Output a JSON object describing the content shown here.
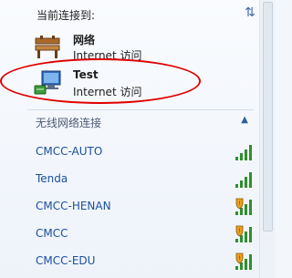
{
  "header": {
    "connected_label": "当前连接到:"
  },
  "connections": [
    {
      "name": "网络",
      "status": "Internet 访问",
      "icon": "bench-network-icon"
    },
    {
      "name": "Test",
      "status": "Internet 访问",
      "icon": "computer-network-icon"
    }
  ],
  "wireless_section": {
    "label": "无线网络连接"
  },
  "wifi_networks": [
    {
      "ssid": "CMCC-AUTO",
      "signal": "full",
      "secured": false
    },
    {
      "ssid": "Tenda",
      "signal": "full",
      "secured": false
    },
    {
      "ssid": "CMCC-HENAN",
      "signal": "full",
      "secured": true
    },
    {
      "ssid": "CMCC",
      "signal": "full",
      "secured": true
    },
    {
      "ssid": "CMCC-EDU",
      "signal": "full",
      "secured": true
    }
  ],
  "colors": {
    "annotation": "#e00000",
    "link": "#1b4f9c",
    "signal": "#2f8f2f"
  }
}
